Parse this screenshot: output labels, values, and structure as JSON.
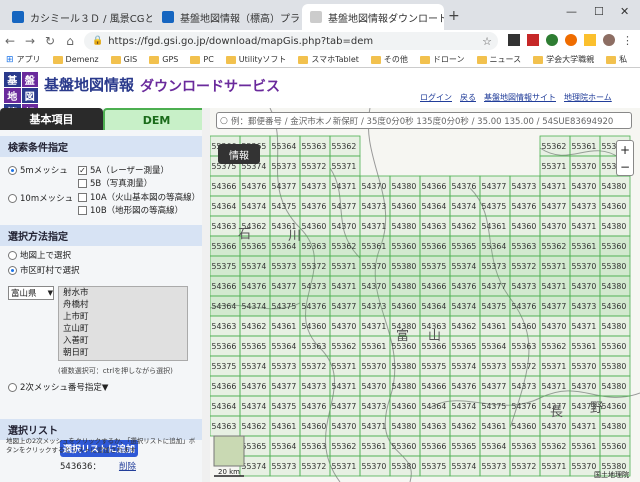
{
  "browser": {
    "tabs": [
      {
        "label": "カシミール３Ｄ / 風景CGと地図とGP",
        "favicon_color": "#1565c0"
      },
      {
        "label": "基盤地図情報（標高）プラグイン / カ",
        "favicon_color": "#1565c0"
      },
      {
        "label": "基盤地図情報ダウンロードサービス",
        "favicon_color": "#cccccc"
      }
    ],
    "new_tab": "+",
    "window_controls": [
      "—",
      "☐",
      "✕"
    ],
    "url": "https://fgd.gsi.go.jp/download/mapGis.php?tab=dem",
    "bookmarks": [
      "アプリ",
      "Demenz",
      "GIS",
      "GPS",
      "PC",
      "Utilityソフト",
      "スマホTablet",
      "その他",
      "ドローン",
      "ニュース",
      "学会大学職親",
      "私"
    ]
  },
  "header": {
    "logo_chars": [
      "基",
      "盤",
      "地",
      "図",
      "情",
      "報"
    ],
    "title": "基盤地図情報",
    "subtitle": "ダウンロードサービス",
    "links": [
      "ログイン",
      "戻る",
      "基盤地図情報サイト",
      "地理院ホーム"
    ]
  },
  "left_panel": {
    "tabs": [
      "基本項目",
      "DEM"
    ],
    "search_section": {
      "title": "検索条件指定",
      "mesh5": "5mメッシュ",
      "mesh10": "10mメッシュ",
      "options5": [
        "5A（レーザー測量）",
        "5B（写真測量）"
      ],
      "options10": [
        "10A（火山基本図の等高線）",
        "10B（地形図の等高線）"
      ]
    },
    "method_section": {
      "title": "選択方法指定",
      "on_map": "地図上で選択",
      "by_city": "市区町村で選択",
      "prefecture": "富山県",
      "cities": [
        "射水市",
        "舟橋村",
        "上市町",
        "立山町",
        "入善町",
        "朝日町"
      ],
      "multi_hint": "(複数選択可：ctrlを押しながら選択)",
      "mesh_number": "2次メッシュ番号指定▼",
      "add_button": "選択リストに追加"
    },
    "list_section": {
      "title": "選択リスト",
      "hint": "地図上の2次メッシュをクリックするか、「選択リストに追加」ボタンをクリックするとリストに追加されます",
      "first_item": "543636：",
      "delete_link": "削除"
    }
  },
  "map": {
    "search_placeholder": "例：郵便番号 / 金沢市木ノ新保町 / 35度0分0秒 135度0分0秒 / 35.00 135.00 / 54SUE83694920",
    "info_button": "情報",
    "zoom_in": "+",
    "zoom_out": "−",
    "place_labels": [
      "石",
      "川",
      "富",
      "山",
      "長",
      "野"
    ],
    "scale_label": "20 km",
    "attribution": "国土地理院",
    "grid_color": "#4caf50",
    "grid_rows": [
      [
        "55366",
        "55365",
        "55364",
        "55363",
        "55362",
        "55361",
        "55360"
      ],
      [
        "55375",
        "55374",
        "55373",
        "55372",
        "55371",
        "55370",
        "55380"
      ],
      [
        "54366",
        "54376",
        "54377",
        "54373",
        "54371",
        "54370",
        "54380"
      ],
      [
        "54364",
        "54374",
        "54375",
        "54376",
        "54377",
        "54373",
        "54360"
      ],
      [
        "54363",
        "54362",
        "54361",
        "54360",
        "54370",
        "54371",
        "54380"
      ]
    ]
  }
}
